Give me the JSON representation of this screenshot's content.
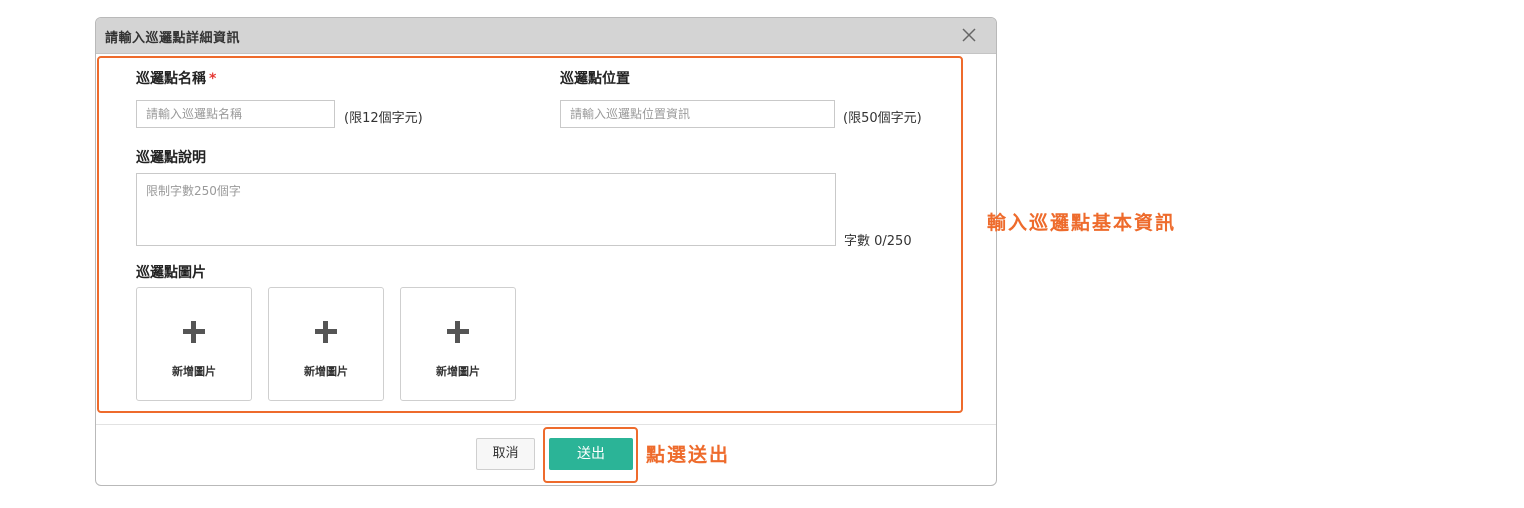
{
  "dialog": {
    "title": "請輸入巡邏點詳細資訊",
    "close_icon": "close-icon"
  },
  "form": {
    "name": {
      "label": "巡邏點名稱",
      "required_mark": "*",
      "placeholder": "請輸入巡邏點名稱",
      "value": "",
      "limit_hint": "(限12個字元)"
    },
    "location": {
      "label": "巡邏點位置",
      "placeholder": "請輸入巡邏點位置資訊",
      "value": "",
      "limit_hint": "(限50個字元)"
    },
    "description": {
      "label": "巡邏點說明",
      "placeholder": "限制字數250個字",
      "value": "",
      "counter": "字數 0/250"
    },
    "images": {
      "label": "巡邏點圖片",
      "tiles": [
        {
          "label": "新增圖片",
          "icon": "plus-icon"
        },
        {
          "label": "新增圖片",
          "icon": "plus-icon"
        },
        {
          "label": "新增圖片",
          "icon": "plus-icon"
        }
      ]
    }
  },
  "footer": {
    "cancel_label": "取消",
    "submit_label": "送出"
  },
  "annotations": {
    "form_note": "輸入巡邏點基本資訊",
    "submit_note": "點選送出",
    "color": "#ee6b2c"
  },
  "colors": {
    "submit_button": "#2bb497",
    "header_bg": "#d4d4d4",
    "required": "#e53935"
  }
}
